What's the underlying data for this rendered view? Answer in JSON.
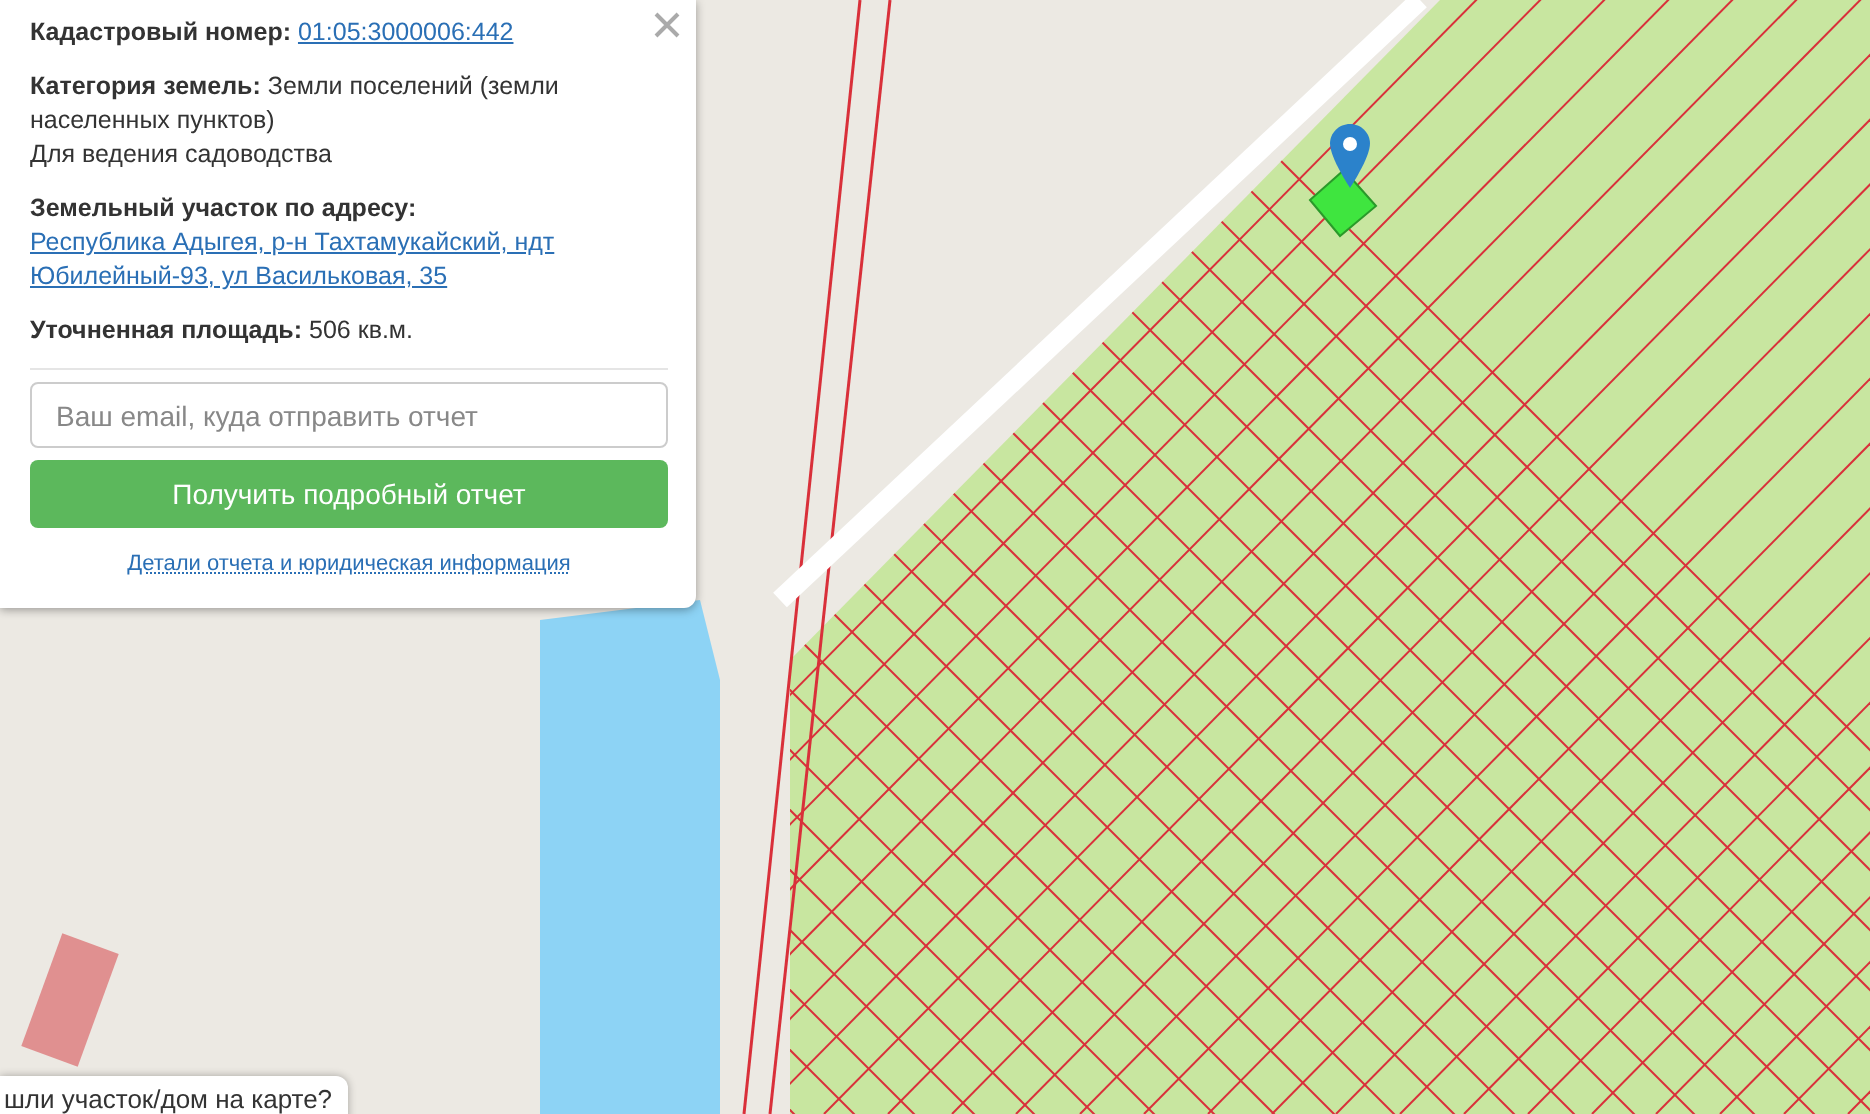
{
  "info_panel": {
    "fields": [
      {
        "kind": "link",
        "label": "Кадастровый номер:",
        "value": "01:05:3000006:442"
      },
      {
        "kind": "text",
        "label": "Категория земель:",
        "value": "Земли поселений (земли населенных пунктов)",
        "note": "Для ведения садоводства"
      },
      {
        "kind": "address",
        "label": "Земельный участок по адресу:",
        "value": "Республика Адыгея, р-н Тахтамукайский, ндт Юбилейный-93, ул Васильковая, 35"
      },
      {
        "kind": "text",
        "label": "Уточненная площадь:",
        "value": "506 кв.м."
      }
    ],
    "email": {
      "placeholder": "Ваш email, куда отправить отчет"
    },
    "button": "Получить подробный отчет",
    "details_link": "Детали отчета и юридическая информация"
  },
  "help_chip": "шли участок/дом на карте?"
}
